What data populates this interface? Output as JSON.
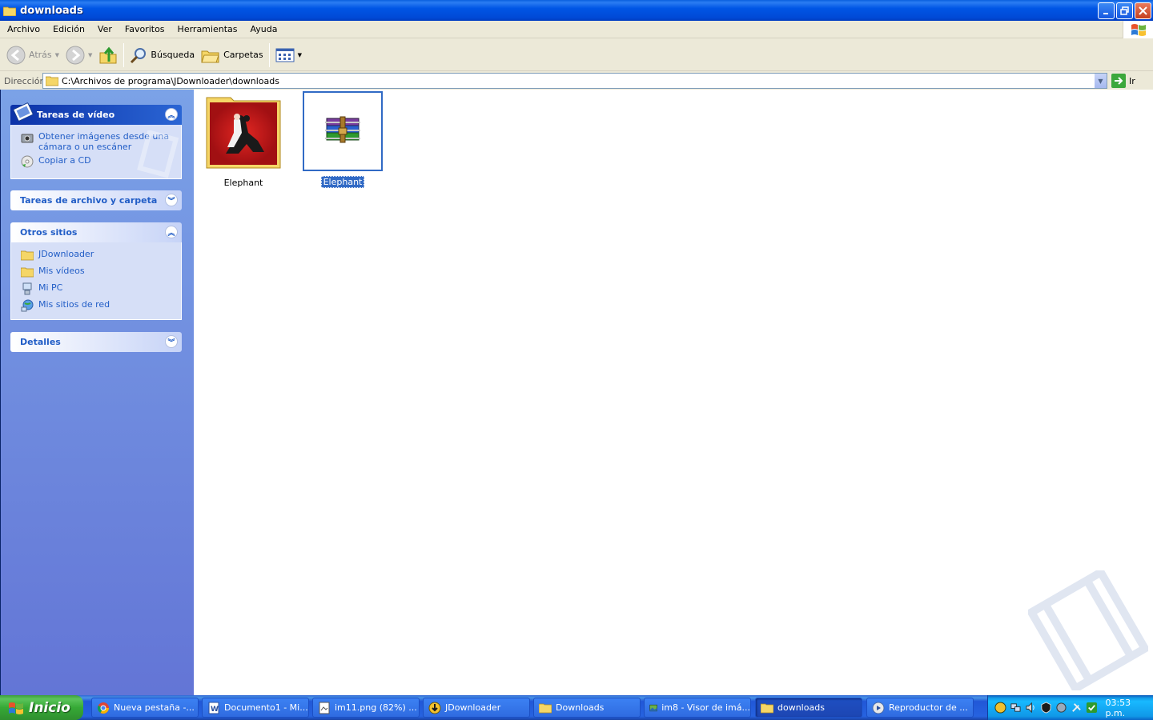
{
  "window": {
    "title": "downloads"
  },
  "menubar": {
    "items": [
      "Archivo",
      "Edición",
      "Ver",
      "Favoritos",
      "Herramientas",
      "Ayuda"
    ]
  },
  "toolbar": {
    "back_label": "Atrás",
    "search_label": "Búsqueda",
    "folders_label": "Carpetas"
  },
  "addressbar": {
    "label": "Dirección",
    "path": "C:\\Archivos de programa\\JDownloader\\downloads",
    "go_label": "Ir"
  },
  "taskpane": {
    "video_tasks": {
      "title": "Tareas de vídeo",
      "items": [
        "Obtener imágenes desde una cámara o un escáner",
        "Copiar a CD"
      ]
    },
    "file_tasks": {
      "title": "Tareas de archivo y carpeta"
    },
    "other_places": {
      "title": "Otros sitios",
      "items": [
        "JDownloader",
        "Mis vídeos",
        "Mi PC",
        "Mis sitios de red"
      ]
    },
    "details": {
      "title": "Detalles"
    }
  },
  "files": [
    {
      "name": "Elephant",
      "type": "folder",
      "selected": false
    },
    {
      "name": "Elephant",
      "type": "rar-archive",
      "selected": true
    }
  ],
  "taskbar": {
    "start_label": "Inicio",
    "tasks": [
      {
        "label": "Nueva pestaña -...",
        "icon": "chrome-icon",
        "active": false
      },
      {
        "label": "Documento1 - Mi...",
        "icon": "word-icon",
        "active": false
      },
      {
        "label": "im11.png (82%) ...",
        "icon": "image-editor-icon",
        "active": false
      },
      {
        "label": "JDownloader",
        "icon": "jdownloader-icon",
        "active": false
      },
      {
        "label": "Downloads",
        "icon": "folder-icon",
        "active": false
      },
      {
        "label": "im8 - Visor de imá...",
        "icon": "image-viewer-icon",
        "active": false
      },
      {
        "label": "downloads",
        "icon": "folder-icon",
        "active": true
      },
      {
        "label": "Reproductor de ...",
        "icon": "media-player-icon",
        "active": false
      }
    ],
    "clock": "03:53 p.m."
  },
  "colors": {
    "titlebar": "#0055e5",
    "taskpane_link": "#215dc6",
    "selection": "#316ac5",
    "start_button": "#36a936"
  }
}
